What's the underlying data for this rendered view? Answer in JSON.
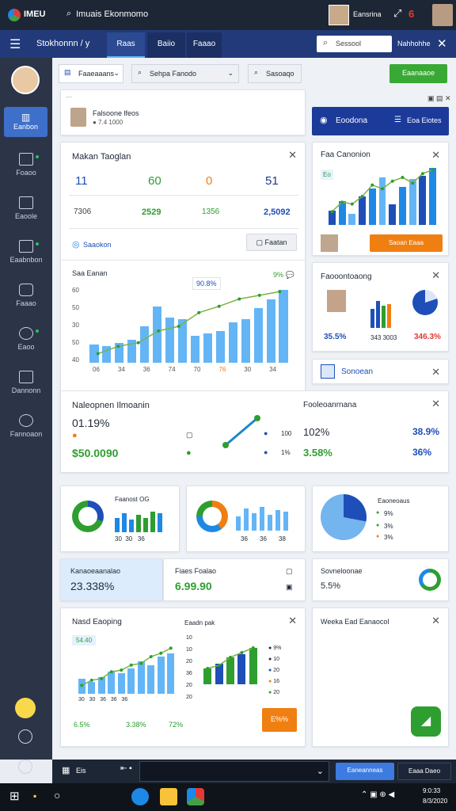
{
  "titlebar": {
    "brand": "IMEU",
    "title": "Imuais Ekonmomo",
    "user": "Eansrina",
    "badge": "6"
  },
  "appbar": {
    "section": "Stokhonnn / y",
    "tabs": [
      "Raas",
      "Baiio",
      "Faaao"
    ],
    "search_placeholder": "Sessool",
    "action": "Nahhohhe"
  },
  "sidebar": {
    "items": [
      "Eanbon",
      "Foaoo",
      "Eaoole",
      "Eaabnbon",
      "Faaao",
      "Eaoo",
      "Dannonn",
      "Fannoaon"
    ]
  },
  "toolbar": {
    "filter1": "Faaeaaans",
    "filter2": "Sehpa Fanodo",
    "filter3": "Sasoaqo",
    "primary": "Eaanaaoe"
  },
  "profile": {
    "name": "Falsoone lfeos",
    "sub": "● 7.4 1000"
  },
  "bluebanner": {
    "left": "Eoodona",
    "right": "Eoa Eiotes"
  },
  "kpi": {
    "title": "Makan Taoglan",
    "values": [
      "11",
      "60",
      "0",
      "51"
    ],
    "sub": [
      "7306",
      "2529",
      "1356",
      "2,5092"
    ],
    "search": "Saaokon",
    "button": "Faatan"
  },
  "main_chart": {
    "title": "Saa Eanan",
    "badge": "90.8%",
    "badge2": "9% 💬"
  },
  "chart_data": [
    {
      "type": "bar",
      "title": "Saa Eanan",
      "categories": [
        "06",
        "34",
        "36",
        "74",
        "70",
        "76",
        "30",
        "34"
      ],
      "values": [
        20,
        18,
        22,
        25,
        40,
        62,
        50,
        48,
        30,
        32,
        35,
        44,
        48,
        60,
        70,
        80
      ],
      "ylim": [
        0,
        80
      ],
      "yticks": [
        "60",
        "50",
        "30",
        "50",
        "40"
      ]
    },
    {
      "type": "line",
      "series": [
        {
          "values": [
            10,
            18,
            22,
            35,
            40,
            55,
            62,
            70,
            74,
            78
          ]
        }
      ]
    }
  ],
  "ratecard": {
    "title": "Faa Canonion",
    "button": "Saoan Eaaa"
  },
  "perf": {
    "title": "Faooontoaong",
    "v1": "35.5%",
    "v2": "343 3003",
    "v3": "346.3%",
    "footer": "Sonoean"
  },
  "mid": {
    "title": "Naleopnen Ilmoanin",
    "v1": "01.19%",
    "v2": "$50.0090",
    "right_title": "Fooleoanrnana",
    "r1": "102%",
    "r2": "3.58%",
    "r3": "38.9%",
    "r4": "36%",
    "l1": "100",
    "l2": "1%"
  },
  "donuts": {
    "c1": "Faanost OG",
    "c2_labels": [
      "36",
      "36",
      "38"
    ],
    "c3_title": "Eaoneoaus",
    "c3_labels": [
      "9%",
      "3%",
      "3%"
    ]
  },
  "stats": {
    "a_title": "Kanaoeaanalao",
    "a_val": "23.338%",
    "b_title": "Fiaes Foalao",
    "b_val": "6.99.90",
    "c_title": "Sovneloonae",
    "c_val": "5.5%"
  },
  "bottom": {
    "title": "Nasd Eaoping",
    "tag": "54.40",
    "sub": "Eaadn pak",
    "vals": [
      "6.5%",
      "3.38%",
      "72%"
    ],
    "labels": [
      "9%",
      "10",
      "20",
      "16",
      "20"
    ],
    "orange_btn": "E%%",
    "right_title": "Weeka Ead Eanaocol"
  },
  "bottombar": {
    "left": "Eis",
    "right1": "Eaneanneas",
    "right2": "Eaaa Daeo"
  },
  "taskbar": {
    "time": "9:0:33",
    "date": "8/3/2020"
  },
  "colors": {
    "blue": "#1e4fb8",
    "green": "#2e9e30",
    "orange": "#f07f12",
    "bar": "#64b5f6"
  }
}
